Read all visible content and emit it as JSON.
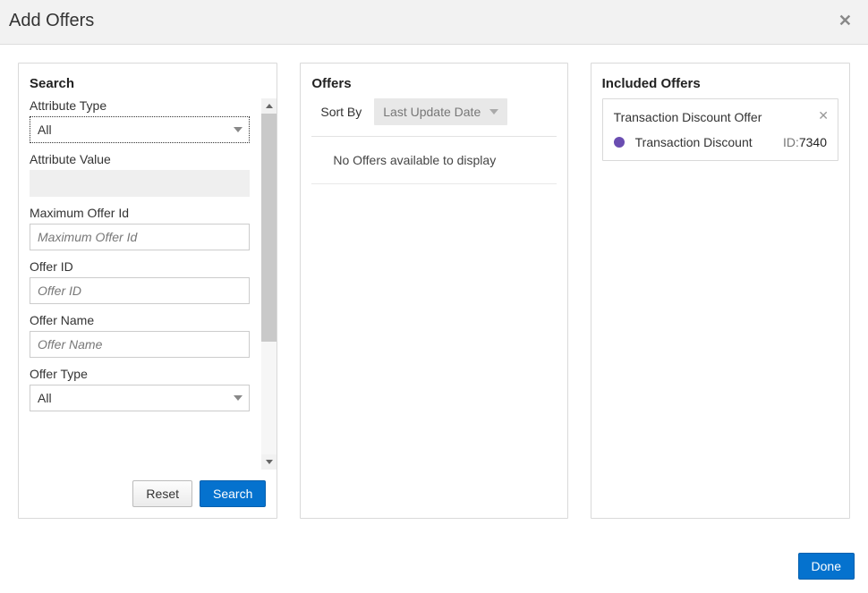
{
  "header": {
    "title": "Add Offers"
  },
  "search": {
    "title": "Search",
    "attribute_type_label": "Attribute Type",
    "attribute_type_value": "All",
    "attribute_value_label": "Attribute Value",
    "attribute_value_value": "",
    "max_offer_id_label": "Maximum Offer Id",
    "max_offer_id_placeholder": "Maximum Offer Id",
    "offer_id_label": "Offer ID",
    "offer_id_placeholder": "Offer ID",
    "offer_name_label": "Offer Name",
    "offer_name_placeholder": "Offer Name",
    "offer_type_label": "Offer Type",
    "offer_type_value": "All",
    "reset_label": "Reset",
    "search_label": "Search"
  },
  "offers": {
    "title": "Offers",
    "sort_by_label": "Sort By",
    "sort_by_value": "Last Update Date",
    "empty_message": "No Offers available to display"
  },
  "included": {
    "title": "Included Offers",
    "card_title": "Transaction Discount Offer",
    "item_name": "Transaction Discount",
    "id_label": "ID:",
    "id_value": "7340",
    "dot_color": "#6a4db1"
  },
  "footer": {
    "done_label": "Done"
  }
}
